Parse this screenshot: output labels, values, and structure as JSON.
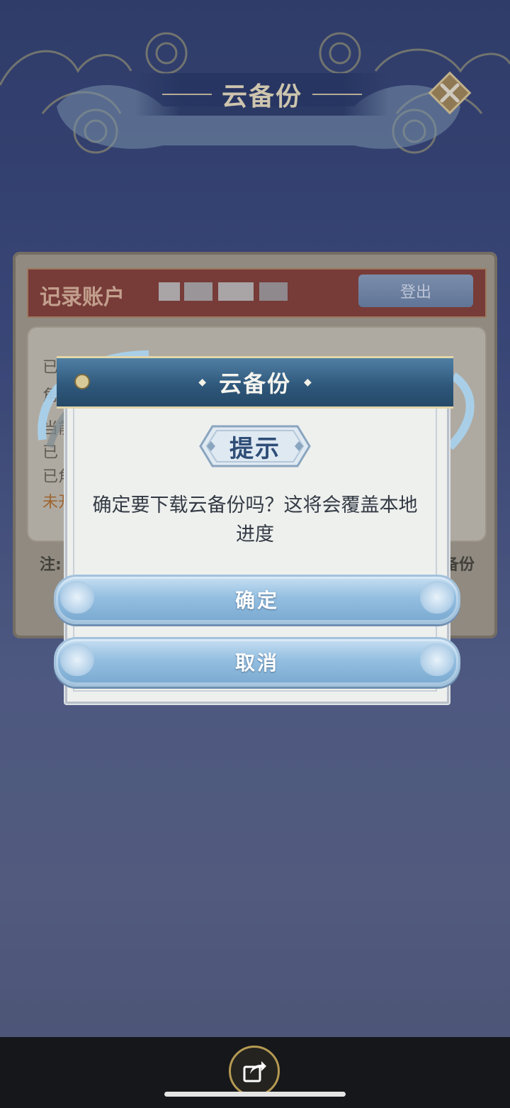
{
  "screen": {
    "title": "云备份",
    "close_icon": "close-icon"
  },
  "background_panel": {
    "account_label": "记录账户",
    "logout_label": "登出",
    "info_lines": [
      "已",
      "角",
      "当前",
      "已",
      "已角",
      "未开"
    ],
    "note_prefix": "注:",
    "note_suffix": "备份"
  },
  "dialog": {
    "title": "云备份",
    "badge": "提示",
    "message": "确定要下载云备份吗？这将会覆盖本地进度",
    "confirm_label": "确定",
    "cancel_label": "取消"
  },
  "bottom_bar": {
    "share_icon": "share-icon"
  },
  "colors": {
    "accent_blue": "#2d5679",
    "button_blue": "#94bfe1",
    "account_bar": "#8a3f33",
    "gold": "#d7c9a5"
  }
}
